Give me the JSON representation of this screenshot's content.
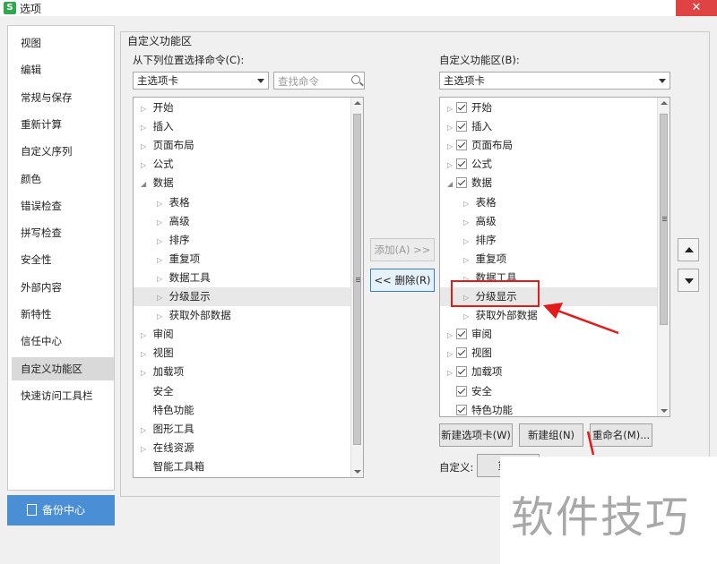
{
  "window": {
    "title": "选项",
    "app_icon": "S",
    "close_glyph": "✕"
  },
  "nav": {
    "items": [
      "视图",
      "编辑",
      "常规与保存",
      "重新计算",
      "自定义序列",
      "颜色",
      "错误检查",
      "拼写检查",
      "安全性",
      "外部内容",
      "新特性",
      "信任中心",
      "自定义功能区",
      "快速访问工具栏"
    ],
    "selected_index": 12,
    "backup_label": "备份中心"
  },
  "group_title": "自定义功能区",
  "left": {
    "label": "从下列位置选择命令(C):",
    "combo_value": "主选项卡",
    "search_placeholder": "查找命令",
    "tree": [
      {
        "text": "开始",
        "level": 0,
        "expander": "▷"
      },
      {
        "text": "插入",
        "level": 0,
        "expander": "▷"
      },
      {
        "text": "页面布局",
        "level": 0,
        "expander": "▷"
      },
      {
        "text": "公式",
        "level": 0,
        "expander": "▷"
      },
      {
        "text": "数据",
        "level": 0,
        "expander": "◢"
      },
      {
        "text": "表格",
        "level": 1,
        "expander": "▷"
      },
      {
        "text": "高级",
        "level": 1,
        "expander": "▷"
      },
      {
        "text": "排序",
        "level": 1,
        "expander": "▷"
      },
      {
        "text": "重复项",
        "level": 1,
        "expander": "▷"
      },
      {
        "text": "数据工具",
        "level": 1,
        "expander": "▷"
      },
      {
        "text": "分级显示",
        "level": 1,
        "expander": "▷",
        "highlight": true
      },
      {
        "text": "获取外部数据",
        "level": 1,
        "expander": "▷"
      },
      {
        "text": "审阅",
        "level": 0,
        "expander": "▷"
      },
      {
        "text": "视图",
        "level": 0,
        "expander": "▷"
      },
      {
        "text": "加载项",
        "level": 0,
        "expander": "▷"
      },
      {
        "text": "安全",
        "level": 0,
        "expander": ""
      },
      {
        "text": "特色功能",
        "level": 0,
        "expander": ""
      },
      {
        "text": "图形工具",
        "level": 0,
        "expander": "▷"
      },
      {
        "text": "在线资源",
        "level": 0,
        "expander": "▷"
      },
      {
        "text": "智能工具箱",
        "level": 0,
        "expander": ""
      }
    ]
  },
  "middle": {
    "add_label": "添加(A) >>",
    "remove_label": "<< 删除(R)"
  },
  "right": {
    "label": "自定义功能区(B):",
    "combo_value": "主选项卡",
    "tree": [
      {
        "text": "开始",
        "level": 0,
        "expander": "▷",
        "checked": true
      },
      {
        "text": "插入",
        "level": 0,
        "expander": "▷",
        "checked": true
      },
      {
        "text": "页面布局",
        "level": 0,
        "expander": "▷",
        "checked": true
      },
      {
        "text": "公式",
        "level": 0,
        "expander": "▷",
        "checked": true
      },
      {
        "text": "数据",
        "level": 0,
        "expander": "◢",
        "checked": true
      },
      {
        "text": "表格",
        "level": 1,
        "expander": "▷"
      },
      {
        "text": "高级",
        "level": 1,
        "expander": "▷"
      },
      {
        "text": "排序",
        "level": 1,
        "expander": "▷"
      },
      {
        "text": "重复项",
        "level": 1,
        "expander": "▷"
      },
      {
        "text": "数据工具",
        "level": 1,
        "expander": "▷"
      },
      {
        "text": "分级显示",
        "level": 1,
        "expander": "▷",
        "highlight": true
      },
      {
        "text": "获取外部数据",
        "level": 1,
        "expander": "▷"
      },
      {
        "text": "审阅",
        "level": 0,
        "expander": "▷",
        "checked": true
      },
      {
        "text": "视图",
        "level": 0,
        "expander": "▷",
        "checked": true
      },
      {
        "text": "加载项",
        "level": 0,
        "expander": "▷",
        "checked": true
      },
      {
        "text": "安全",
        "level": 0,
        "expander": "",
        "checked": true
      },
      {
        "text": "特色功能",
        "level": 0,
        "expander": "",
        "checked": true
      }
    ],
    "new_tab_label": "新建选项卡(W)",
    "new_group_label": "新建组(N)",
    "rename_label": "重命名(M)...",
    "custom_label": "自定义:",
    "reset_label": "重置"
  },
  "watermark": "软件技巧",
  "colors": {
    "annotation_red": "#e21b1b",
    "backup_blue": "#4a8fd6",
    "close_red": "#e04343"
  }
}
